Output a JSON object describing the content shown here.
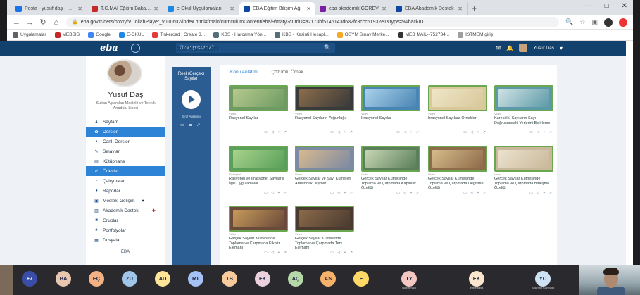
{
  "browser": {
    "tabs": [
      {
        "label": "Posta - yusuf daş - Out",
        "color": "#1a73e8",
        "active": false
      },
      {
        "label": "T.C.MAİ Eğitim Bakanlı",
        "color": "#c62828",
        "active": false
      },
      {
        "label": "e-Okul Uygulamaları",
        "color": "#1e88e5",
        "active": false
      },
      {
        "label": "EBA Eğitim Bilişim Ağı",
        "color": "#0d47a1",
        "active": true
      },
      {
        "label": "eba akademik GÖREV",
        "color": "#7b1fa2",
        "active": false
      },
      {
        "label": "EBA Akademik Destek",
        "color": "#0d47a1",
        "active": false
      }
    ],
    "new_tab": "+",
    "window_controls": {
      "minimize": "—",
      "maximize": "□",
      "close": "✕"
    },
    "nav": {
      "back": "←",
      "forward": "→",
      "reload": "↻",
      "home": "⌂"
    },
    "url": "eba.gov.tr/ders/proxy/VCollabPlayer_v0.0.602/index.html#/main/curriculumContent/eba/9/maty?curriD=a2173bf5146143d682fc3ccc51932e1&type=9&backID...",
    "lock": "🔒",
    "addr_icons": {
      "search": "🔍",
      "star": "☆",
      "ext": "▣"
    },
    "bookmarks": [
      {
        "label": "Uygulamalar",
        "color": "#5f6368"
      },
      {
        "label": "MEBBIS",
        "color": "#c62828"
      },
      {
        "label": "Google",
        "color": "#4285f4"
      },
      {
        "label": "E-OKUL",
        "color": "#1e88e5"
      },
      {
        "label": "Tinkercad | Create 3...",
        "color": "#e53935"
      },
      {
        "label": "KBS - Harcama Yön...",
        "color": "#546e7a"
      },
      {
        "label": "KBS - Kesinti Hesapl...",
        "color": "#546e7a"
      },
      {
        "label": "ÖSYM Sınav Merke...",
        "color": "#f9a825"
      },
      {
        "label": "MEB MAIL--752734...",
        "color": "#333333"
      },
      {
        "label": "İSTMEM giriş",
        "color": "#9e9e9e"
      }
    ]
  },
  "eba": {
    "logo": "eba",
    "search_placeholder": "Ne arıyorsunuz?",
    "search_icon": "🔍",
    "mail_icon": "✉",
    "bell_icon": "🔔",
    "user_label": "Yusuf Daş",
    "caret": "▾",
    "page_heading": "Sayı Kümeleri"
  },
  "profile": {
    "name": "Yusuf Daş",
    "school": "Sultan Alparslan Mesleki ve Teknik Anadolu Lisesi",
    "menu": [
      {
        "label": "Sayfam",
        "icon": "♟",
        "active": false
      },
      {
        "label": "Dersler",
        "icon": "✿",
        "active": true
      },
      {
        "label": "Canlı Dersler",
        "icon": "▪",
        "active": false
      },
      {
        "label": "Sınavlar",
        "icon": "✎",
        "active": false
      },
      {
        "label": "Kütüphane",
        "icon": "▤",
        "active": false
      },
      {
        "label": "Ödevler",
        "icon": "✐",
        "active": true
      },
      {
        "label": "Çalışmalar",
        "icon": "◔",
        "active": false
      },
      {
        "label": "Raporlar",
        "icon": "◑",
        "active": false
      },
      {
        "label": "Mesleki Gelişim",
        "icon": "▣",
        "active": false,
        "caret": "▾"
      },
      {
        "label": "Akademik Destek",
        "icon": "▥",
        "active": false,
        "badge": "✚"
      },
      {
        "label": "Gruplar",
        "icon": "■",
        "active": false
      },
      {
        "label": "Portfolyolar",
        "icon": "♣",
        "active": false
      },
      {
        "label": "Dosyalar",
        "icon": "▦",
        "active": false
      }
    ],
    "logo_text": "EBA"
  },
  "video_panel": {
    "title": "Reel (Gerçek) Sayılar",
    "subtitle": "Sınıf Anlatımı",
    "icons": [
      "▭",
      "☰",
      "↗"
    ]
  },
  "main": {
    "tabs": [
      {
        "label": "Konu Anlatımı",
        "active": true
      },
      {
        "label": "Çözümlü Örnek",
        "active": false
      }
    ],
    "cards": [
      {
        "tag": "Video",
        "title": "Rasyonel Sayılar",
        "c1": "#6f9b63",
        "c2": "#b5c98e"
      },
      {
        "tag": "Video",
        "title": "Rasyonel Sayıların Yoğunluğu",
        "c1": "#3a3a3a",
        "c2": "#8a6c4a"
      },
      {
        "tag": "Video",
        "title": "İrrasyonel Sayılar",
        "c1": "#4a86b4",
        "c2": "#a8d0ea"
      },
      {
        "tag": "Video",
        "title": "İrrasyonel Sayılara Örnekler",
        "c1": "#d8c89a",
        "c2": "#efe6c8"
      },
      {
        "tag": "Video",
        "title": "Karekökü Sayıların Sayı Doğrusundaki Yerlerini Belirleme",
        "c1": "#5c9aa8",
        "c2": "#cfe2e4"
      },
      {
        "tag": "Etkileşimli",
        "title": "Rasyonel ve İrrasyonel Sayılarla İlgili Uygulamalar",
        "c1": "#5aa05a",
        "c2": "#a9d38c"
      },
      {
        "tag": "Video",
        "title": "Gerçek Sayılar ve Sayı Kümeleri Arasındaki İlişkiler",
        "c1": "#7d8aa3",
        "c2": "#d7b98e"
      },
      {
        "tag": "Video",
        "title": "Gerçek Sayılar Kümesinde Toplama ve Çarpmada Kapalılık Özeliği",
        "c1": "#5a7f5a",
        "c2": "#c8d6b4"
      },
      {
        "tag": "Video",
        "title": "Gerçek Sayılar Kümesinde Toplama ve Çarpmada Değişme Özeliği",
        "c1": "#8e6b4a",
        "c2": "#d6bb8a"
      },
      {
        "tag": "Video",
        "title": "Gerçek Sayılar Kümesinde Toplama ve Çarpmada Birleşme Özeliği",
        "c1": "#c9b99a",
        "c2": "#ece2cf"
      },
      {
        "tag": "Video",
        "title": "Gerçek Sayılar Kümesinde Toplama ve Çarpmada Etkisiz Elemanı",
        "c1": "#6a4a3a",
        "c2": "#c79a5a"
      },
      {
        "tag": "Video",
        "title": "Gerçek Sayılar Kümesinde Toplama ve Çarpmada Ters Elemanı",
        "c1": "#4a3a2f",
        "c2": "#8a6a4a"
      }
    ],
    "card_actions": "▭ ◁ + ↗"
  },
  "meeting": {
    "participants": [
      {
        "initials": "+7",
        "color": "#3a4ea8",
        "text_color": "#ffffff",
        "name": ""
      },
      {
        "initials": "BA",
        "color": "#e8c6b0",
        "text_color": "#1f2a44",
        "name": ""
      },
      {
        "initials": "EÇ",
        "color": "#f4b183",
        "text_color": "#1f2a44",
        "name": ""
      },
      {
        "initials": "ZU",
        "color": "#9fc5e8",
        "text_color": "#1f2a44",
        "name": ""
      },
      {
        "initials": "AD",
        "color": "#ffe599",
        "text_color": "#1f2a44",
        "name": ""
      },
      {
        "initials": "RT",
        "color": "#a4c2f4",
        "text_color": "#1f2a44",
        "name": ""
      },
      {
        "initials": "TB",
        "color": "#f9cb9c",
        "text_color": "#1f2a44",
        "name": ""
      },
      {
        "initials": "FK",
        "color": "#ead1dc",
        "text_color": "#1f2a44",
        "name": ""
      },
      {
        "initials": "AÇ",
        "color": "#b6d7a8",
        "text_color": "#1f2a44",
        "name": ""
      },
      {
        "initials": "AS",
        "color": "#f6b26b",
        "text_color": "#1f2a44",
        "name": ""
      },
      {
        "initials": "E",
        "color": "#ffd966",
        "text_color": "#1f2a44",
        "name": ""
      },
      {
        "initials": "TY",
        "color": "#f4c7c3",
        "text_color": "#1f2a44",
        "name": "Tuğba Yalçı"
      },
      {
        "initials": "EK",
        "color": "#fce5cd",
        "text_color": "#1f2a44",
        "name": "emre kaya"
      },
      {
        "initials": "YC",
        "color": "#cfe2f3",
        "text_color": "#1f2a44",
        "name": "Yasemin Canbulat"
      }
    ]
  }
}
